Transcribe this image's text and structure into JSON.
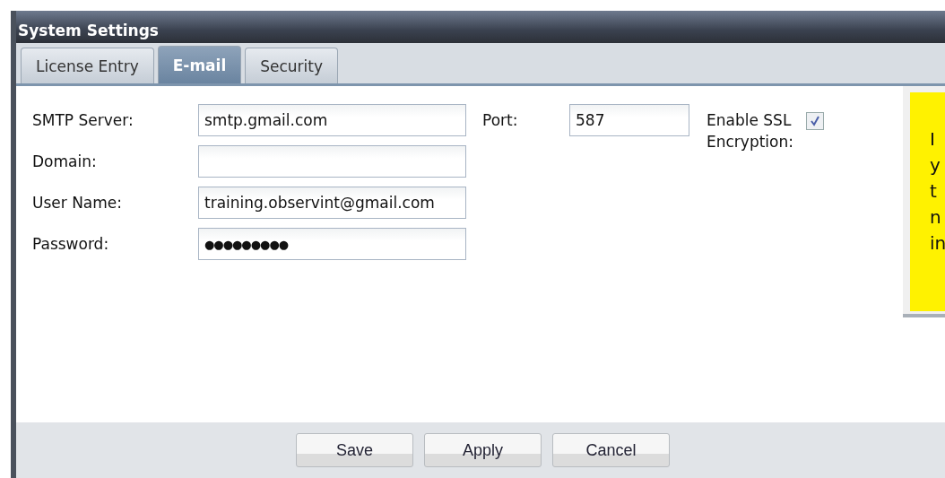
{
  "window": {
    "title": "System Settings"
  },
  "tabs": [
    {
      "label": "License Entry",
      "selected": false
    },
    {
      "label": "E-mail",
      "selected": true
    },
    {
      "label": "Security",
      "selected": false
    }
  ],
  "fields": [
    {
      "label": "SMTP Server:",
      "value": "smtp.gmail.com",
      "kind": "text"
    },
    {
      "label": "Domain:",
      "kind": "text"
    },
    {
      "label": "User Name:",
      "value": "training.observint@gmail.com",
      "kind": "text"
    },
    {
      "label": "Password:",
      "value": "●●●●●●●●●",
      "kind": "password"
    }
  ],
  "port": {
    "label": "Port:",
    "value": "587"
  },
  "ssl": {
    "label": "Enable SSL Encryption:",
    "checked": true
  },
  "callout": {
    "lines": [
      "I",
      "y",
      "t",
      "n",
      "in"
    ]
  },
  "buttons": [
    "Save",
    "Apply",
    "Cancel"
  ]
}
